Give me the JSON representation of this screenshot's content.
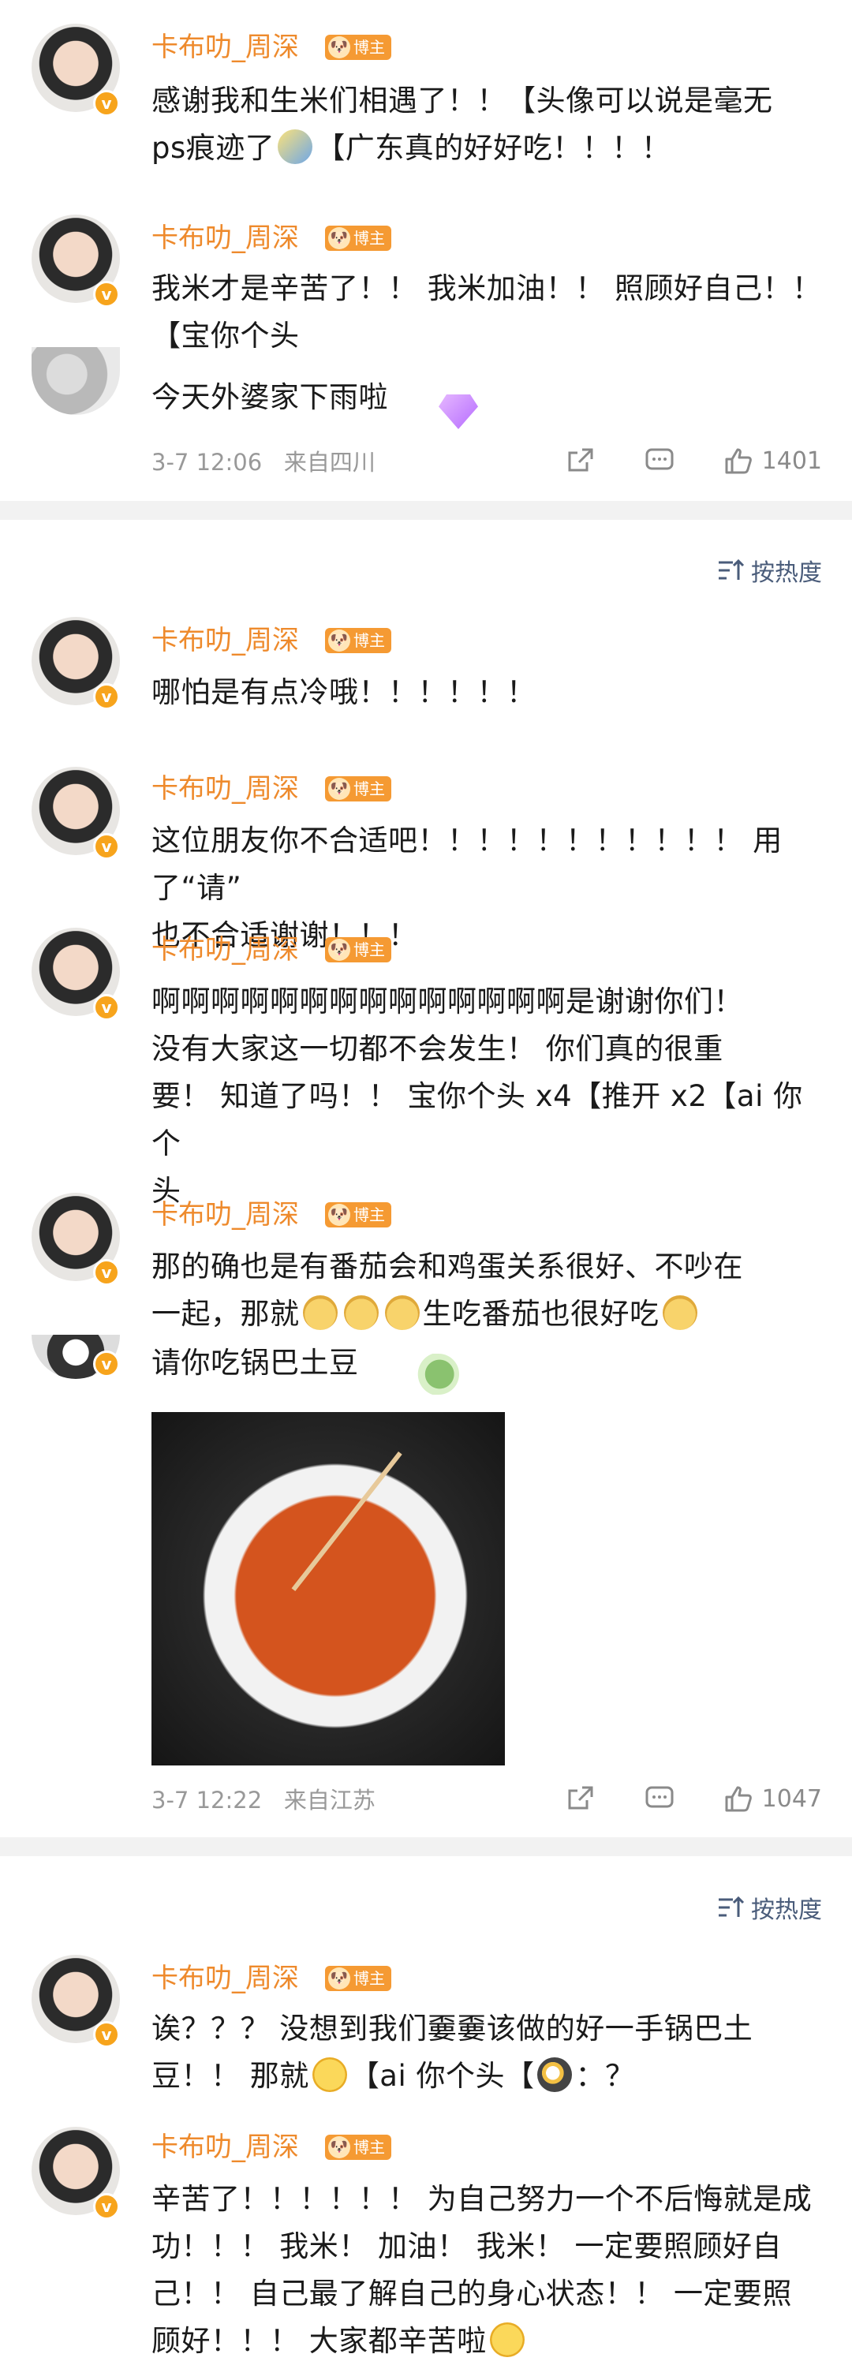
{
  "author_name": "卡布叻_周深",
  "blogger_label": "博主",
  "c1": {
    "line1": "感谢我和生米们相遇了！！【头像可以说是毫无",
    "line2": "ps痕迹了",
    "line2b": "【广东真的好好吃！！！！",
    "reply": "我米才是辛苦了！！ 我米加油！！ 照顾好自己！！",
    "reply2": "【宝你个头",
    "sub": "今天外婆家下雨啦",
    "time": "3-7 12:06",
    "location": "来自四川",
    "likes": "1401"
  },
  "sort_label": "按热度",
  "c2": {
    "r1": "哪怕是有点冷哦！！！！！！",
    "r2a": "这位朋友你不合适吧！！！！！！！！！！！ 用了“请”",
    "r2b": "也不合适谢谢！！！",
    "r3a": "啊啊啊啊啊啊啊啊啊啊啊啊啊啊是谢谢你们！",
    "r3b": "没有大家这一切都不会发生！ 你们真的很重",
    "r3c": "要！ 知道了吗！！ 宝你个头 x4【推开 x2【ai 你个",
    "r3d": "头",
    "r4a": "那的确也是有番茄会和鸡蛋关系很好、不吵在",
    "r4b": "一起，那就",
    "r4b2": "生吃番茄也很好吃",
    "sub": "请你吃锅巴土豆",
    "time": "3-7 12:22",
    "location": "来自江苏",
    "likes": "1047"
  },
  "c3": {
    "r1a": "诶？？？ 没想到我们嫑嫑该做的好一手锅巴土",
    "r1b": "豆！！ 那就",
    "r1b2": "【ai 你个头【",
    "r1b3": "：？",
    "r2a": "辛苦了！！！！！！ 为自己努力一个不后悔就是成",
    "r2b": "功！！！ 我米！ 加油！ 我米！ 一定要照顾好自",
    "r2c": "己！！ 自己最了解自己的身心状态！！ 一定要照",
    "r2d": "顾好！！！ 大家都辛苦啦"
  },
  "colors": {
    "name": "#ee8a2c",
    "badge": "#f59a33",
    "sort": "#4a5c7a",
    "muted": "#999999"
  }
}
